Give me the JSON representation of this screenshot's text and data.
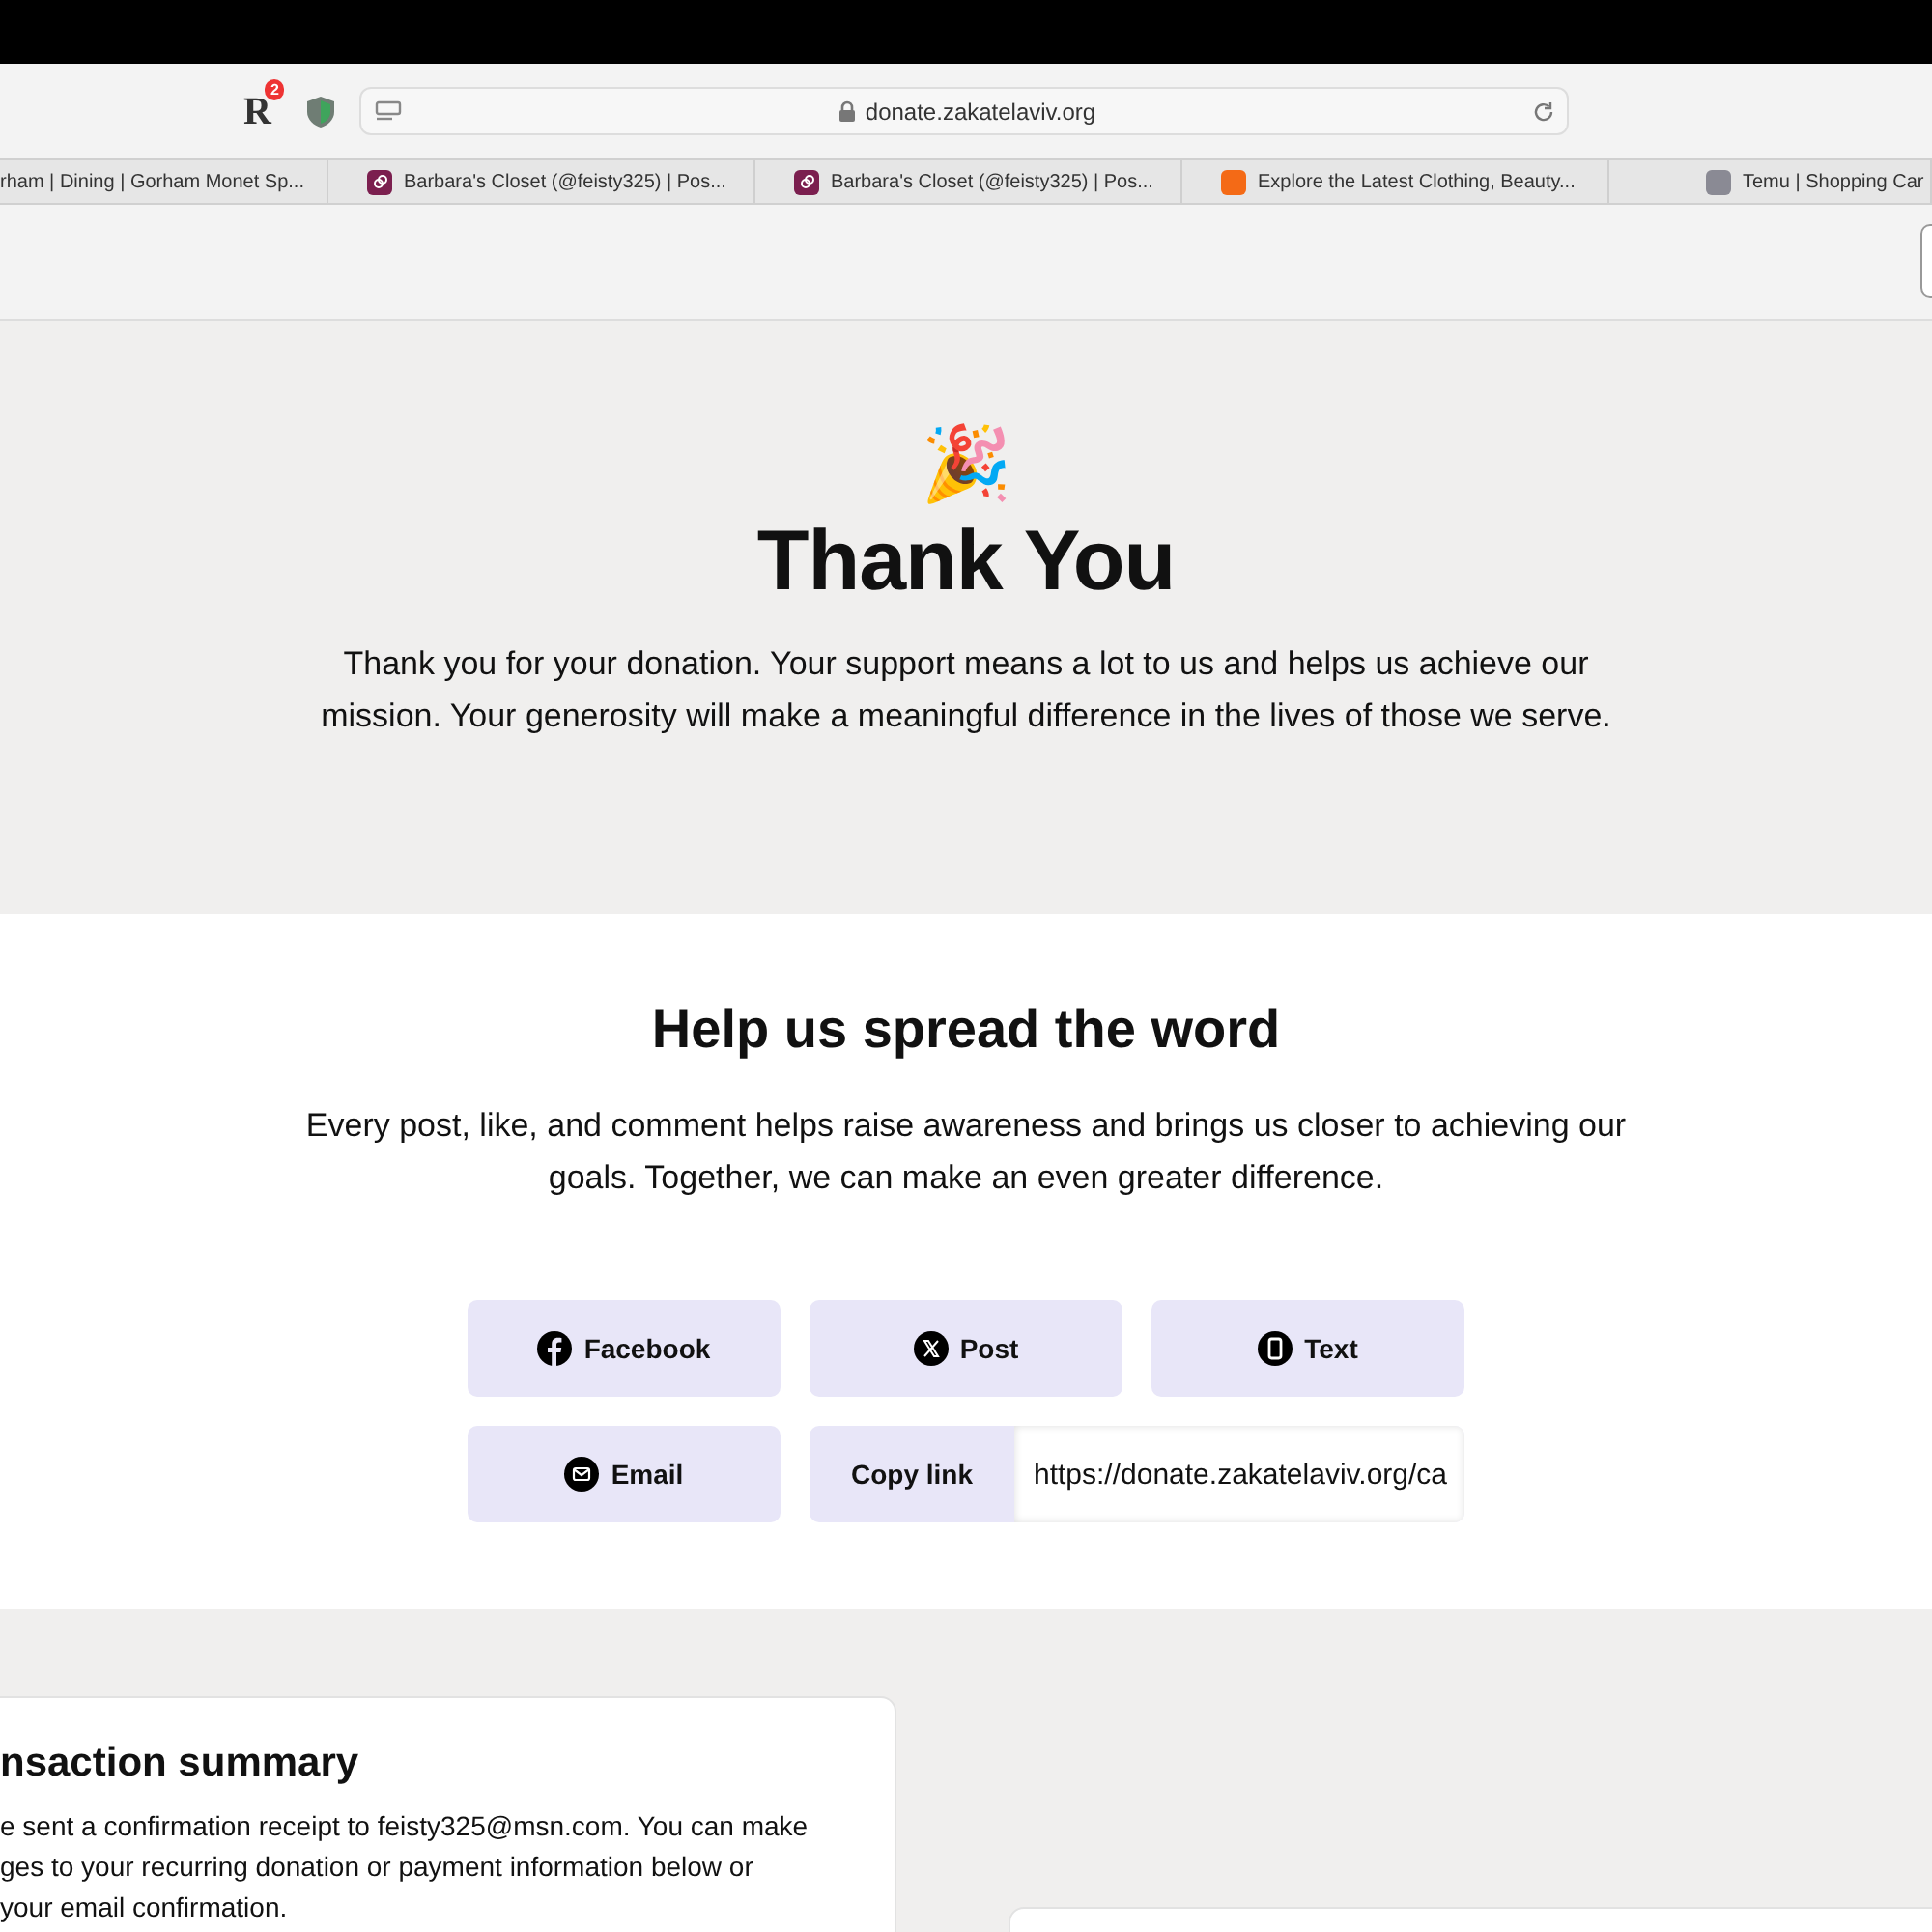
{
  "toolbar": {
    "extension_logo": "R",
    "extension_badge": "2",
    "address": "donate.zakatelaviv.org"
  },
  "tabs": [
    {
      "title": "rham | Dining | Gorham Monet Sp...",
      "selected": false
    },
    {
      "title": "Barbara's Closet (@feisty325) | Pos...",
      "selected": false
    },
    {
      "title": "Barbara's Closet (@feisty325) | Pos...",
      "selected": false
    },
    {
      "title": "Explore the Latest Clothing, Beauty...",
      "selected": false
    },
    {
      "title": "Temu | Shopping Car",
      "selected": false
    }
  ],
  "hero": {
    "emoji": "🎉",
    "title": "Thank You",
    "text": "Thank you for your donation. Your support means a lot to us and helps us achieve our mission. Your generosity will make a meaningful difference in the lives of those we serve."
  },
  "share": {
    "title": "Help us spread the word",
    "text": "Every post, like, and comment helps raise awareness and brings us closer to achieving our goals. Together, we can make an even greater difference.",
    "buttons": [
      {
        "kind": "facebook",
        "label": "Facebook"
      },
      {
        "kind": "x",
        "label": "Post"
      },
      {
        "kind": "phone",
        "label": "Text"
      },
      {
        "kind": "email",
        "label": "Email"
      }
    ],
    "copy_link": {
      "label": "Copy link",
      "value": "https://donate.zakatelaviv.org/ca"
    }
  },
  "summary": {
    "title": "nsaction summary",
    "lines": [
      "e sent a confirmation receipt to feisty325@msn.com. You can make",
      "ges to your recurring donation or payment information below or",
      "your email confirmation."
    ]
  }
}
